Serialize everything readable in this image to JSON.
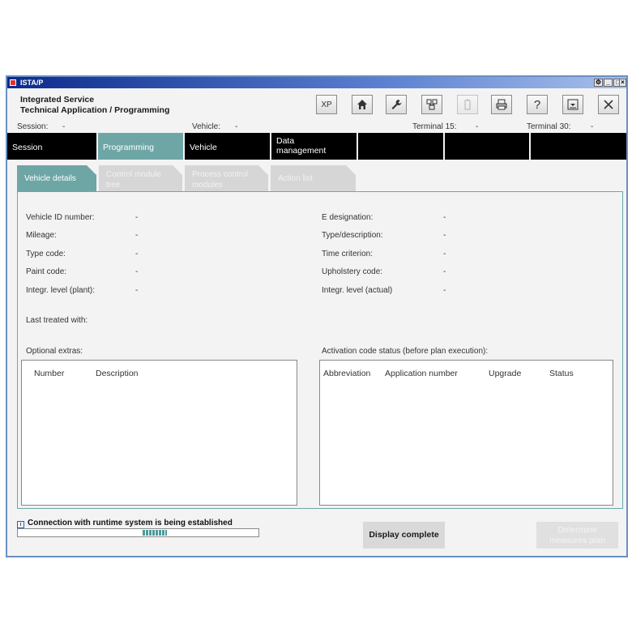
{
  "window": {
    "title": "ISTA/P",
    "controls": {
      "extra": "⚙",
      "minimize": "_",
      "maximize": "□",
      "close": "×"
    }
  },
  "header": {
    "line1": "Integrated Service",
    "line2": "Technical Application / Programming"
  },
  "toolbar": {
    "xp_label": "XP",
    "icons": [
      "xp-icon",
      "home-icon",
      "wrench-icon",
      "vehicle-data-icon",
      "battery-icon",
      "printer-icon",
      "help-icon",
      "minimize-panel-icon",
      "close-icon"
    ],
    "help_label": "?"
  },
  "status": {
    "session_label": "Session:",
    "session_value": "-",
    "vehicle_label": "Vehicle:",
    "vehicle_value": "-",
    "terminal15_label": "Terminal 15:",
    "terminal15_value": "-",
    "terminal30_label": "Terminal 30:",
    "terminal30_value": "-"
  },
  "nav": {
    "tabs": [
      {
        "label": "Session",
        "active": false
      },
      {
        "label": "Programming",
        "active": true
      },
      {
        "label": "Vehicle",
        "active": false
      },
      {
        "label": "Data management",
        "active": false
      },
      {
        "label": "",
        "active": false
      },
      {
        "label": "",
        "active": false
      },
      {
        "label": "",
        "active": false
      }
    ]
  },
  "subtabs": [
    {
      "label": "Vehicle details",
      "active": true
    },
    {
      "label": "Control module tree",
      "active": false
    },
    {
      "label": "Process control modules",
      "active": false
    },
    {
      "label": "Action list",
      "active": false
    }
  ],
  "details": {
    "left": [
      {
        "label": "Vehicle ID number:",
        "value": "-"
      },
      {
        "label": "Mileage:",
        "value": "-"
      },
      {
        "label": "Type code:",
        "value": "-"
      },
      {
        "label": "Paint code:",
        "value": "-"
      },
      {
        "label": "Integr. level (plant):",
        "value": "-"
      }
    ],
    "right": [
      {
        "label": "E designation:",
        "value": "-"
      },
      {
        "label": "Type/description:",
        "value": "-"
      },
      {
        "label": "Time criterion:",
        "value": "-"
      },
      {
        "label": "Upholstery code:",
        "value": "-"
      },
      {
        "label": "Integr. level (actual)",
        "value": "-"
      }
    ],
    "last_treated_label": "Last treated with:"
  },
  "optional_extras": {
    "title": "Optional extras:",
    "columns": [
      "Number",
      "Description"
    ]
  },
  "activation": {
    "title": "Activation code status (before plan execution):",
    "columns": [
      "Abbreviation",
      "Application number",
      "Upgrade",
      "Status"
    ]
  },
  "connection": {
    "message": "Connection with runtime system is being established",
    "progress": 0.1
  },
  "buttons": {
    "display_complete": "Display complete",
    "determine_plan": "Determine measures plan"
  },
  "colors": {
    "accent": "#6ea6a6",
    "titlebar": "#0c2a8c"
  }
}
